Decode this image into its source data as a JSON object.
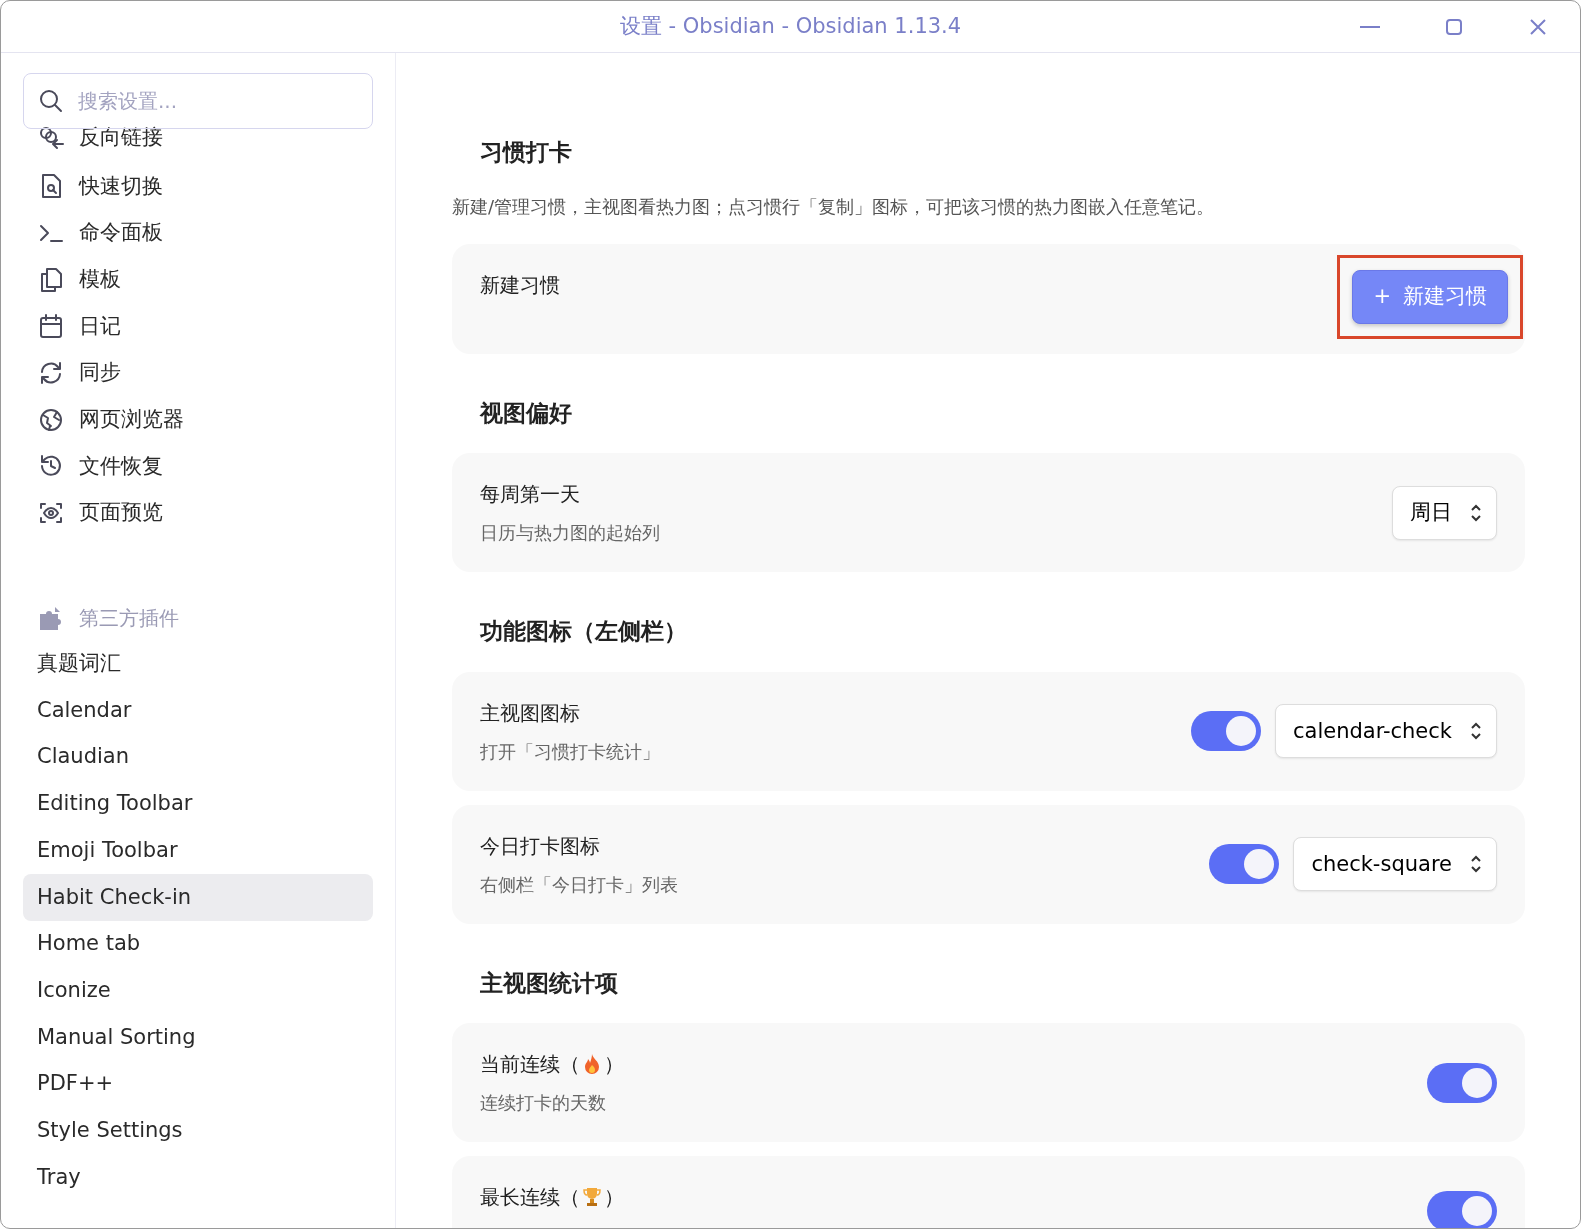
{
  "window": {
    "title": "设置 - Obsidian - Obsidian 1.13.4"
  },
  "sidebar": {
    "search": {
      "placeholder": "搜索设置..."
    },
    "core_items": [
      {
        "label": "反向链接"
      },
      {
        "label": "快速切换"
      },
      {
        "label": "命令面板"
      },
      {
        "label": "模板"
      },
      {
        "label": "日记"
      },
      {
        "label": "同步"
      },
      {
        "label": "网页浏览器"
      },
      {
        "label": "文件恢复"
      },
      {
        "label": "页面预览"
      }
    ],
    "plugins_heading": "第三方插件",
    "plugin_items": [
      {
        "label": "真题词汇",
        "selected": false
      },
      {
        "label": "Calendar",
        "selected": false
      },
      {
        "label": "Claudian",
        "selected": false
      },
      {
        "label": "Editing Toolbar",
        "selected": false
      },
      {
        "label": "Emoji Toolbar",
        "selected": false
      },
      {
        "label": "Habit Check-in",
        "selected": true
      },
      {
        "label": "Home tab",
        "selected": false
      },
      {
        "label": "Iconize",
        "selected": false
      },
      {
        "label": "Manual Sorting",
        "selected": false
      },
      {
        "label": "PDF++",
        "selected": false
      },
      {
        "label": "Style Settings",
        "selected": false
      },
      {
        "label": "Tray",
        "selected": false
      }
    ]
  },
  "sections": [
    {
      "heading": "习惯打卡",
      "description": "新建/管理习惯，主视图看热力图；点习惯行「复制」图标，可把该习惯的热力图嵌入任意笔记。",
      "rows": [
        {
          "kind": "button",
          "name": "新建习惯",
          "button": {
            "icon": "+",
            "label": "新建习惯",
            "highlighted": true
          }
        }
      ]
    },
    {
      "heading": "视图偏好",
      "rows": [
        {
          "kind": "dropdown",
          "name": "每周第一天",
          "description": "日历与热力图的起始列",
          "value": "周日"
        }
      ]
    },
    {
      "heading": "功能图标（左侧栏）",
      "rows": [
        {
          "kind": "toggle_dropdown",
          "name": "主视图图标",
          "description": "打开「习惯打卡统计」",
          "on": true,
          "value": "calendar-check"
        },
        {
          "kind": "toggle_dropdown",
          "name": "今日打卡图标",
          "description": "右侧栏「今日打卡」列表",
          "on": true,
          "value": "check-square"
        }
      ]
    },
    {
      "heading": "主视图统计项",
      "rows": [
        {
          "kind": "toggle",
          "name": "当前连续（",
          "name_suffix": "）",
          "description": "连续打卡的天数",
          "on": true
        },
        {
          "kind": "toggle",
          "name": "最长连续（",
          "name_suffix": "）",
          "on": true
        }
      ]
    }
  ]
}
